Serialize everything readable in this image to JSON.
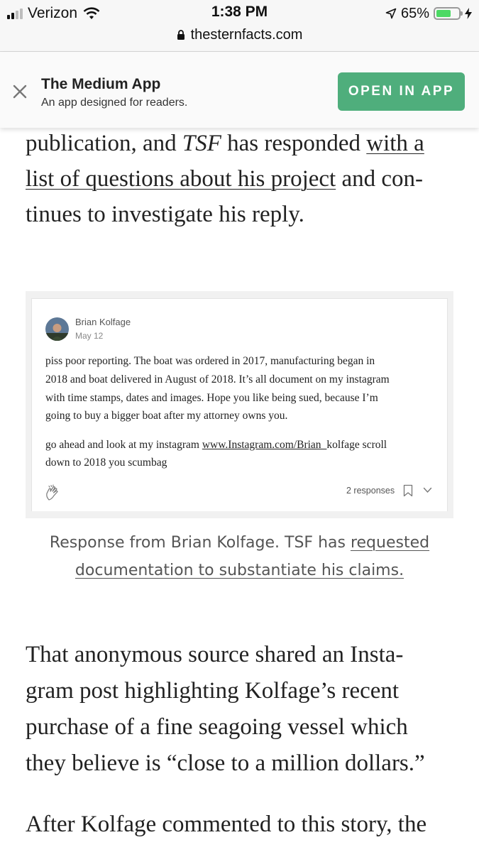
{
  "status_bar": {
    "carrier": "Verizon",
    "time": "1:38 PM",
    "battery_percent": "65%",
    "battery_level": 0.65,
    "url": "thesternfacts.com"
  },
  "banner": {
    "app_name": "The Medium App",
    "tagline": "An app designed for readers.",
    "button_label": "OPEN IN APP",
    "button_color": "#4fae7c"
  },
  "article": {
    "para1": {
      "l1_a": "publication, and ",
      "l1_em": "TSF",
      "l1_b": " has responded ",
      "l1_link": "with a",
      "l2_link": "list of questions about his project",
      "l2_b": " and con-",
      "l3": "tinues to investigate his reply."
    },
    "response": {
      "author": "Brian Kolfage",
      "date": "May 12",
      "lines": [
        "piss poor reporting. The boat was ordered in 2017, manufacturing began in",
        "2018 and boat delivered in August of 2018. It’s all document on my instagram",
        "with time stamps, dates and images. Hope you like being sued, because I’m",
        "going to buy a bigger boat after my attorney owns you."
      ],
      "line5_a": "go ahead and look at my instagram ",
      "line5_link": "www.Instagram.com/Brian_",
      "line5_b": "kolfage scroll",
      "line6": "down to 2018 you scumbag",
      "responses_label": "2 responses"
    },
    "caption": {
      "l1_a": "Response from Brian Kolfage. TSF has ",
      "l1_link": "requested",
      "l2_link": "documentation to substantiate his claims."
    },
    "para2": [
      "That anonymous source shared an Insta-",
      "gram post highlighting Kolfage’s recent",
      "purchase of a fine seagoing vessel which",
      "they believe is “close to a million dollars.”"
    ],
    "para3": "After Kolfage commented to this story, the"
  }
}
